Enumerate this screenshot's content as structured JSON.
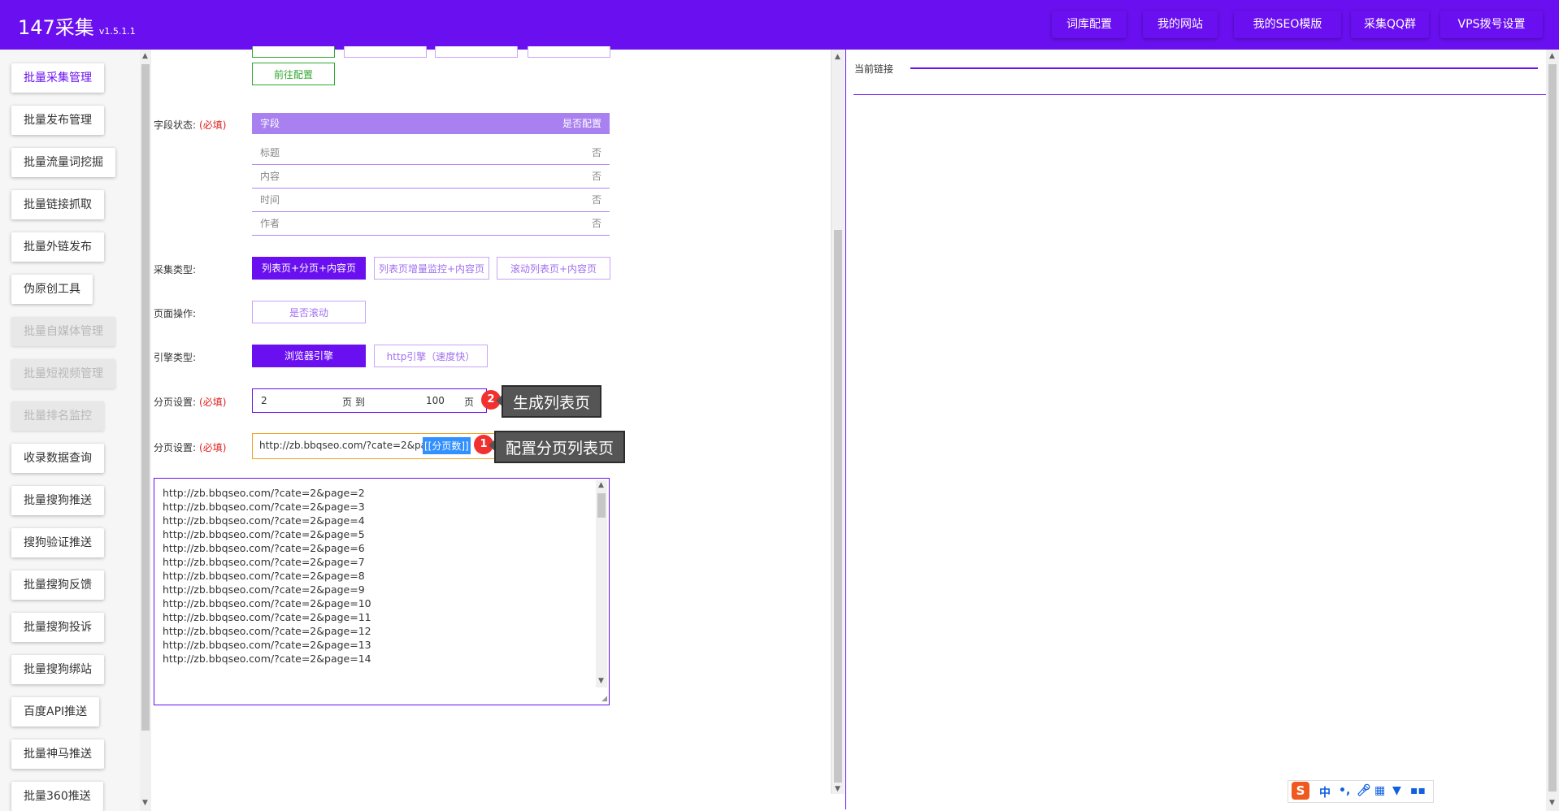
{
  "header": {
    "brand": "147采集",
    "version": "v1.5.1.1",
    "nav": [
      "词库配置",
      "我的网站",
      "我的SEO模版",
      "采集QQ群",
      "VPS拨号设置"
    ]
  },
  "sidebar": {
    "items": [
      {
        "label": "批量采集管理",
        "state": "active"
      },
      {
        "label": "批量发布管理",
        "state": "normal"
      },
      {
        "label": "批量流量词挖掘",
        "state": "normal"
      },
      {
        "label": "批量链接抓取",
        "state": "normal"
      },
      {
        "label": "批量外链发布",
        "state": "normal"
      },
      {
        "label": "伪原创工具",
        "state": "normal"
      },
      {
        "label": "批量自媒体管理",
        "state": "disabled"
      },
      {
        "label": "批量短视频管理",
        "state": "disabled"
      },
      {
        "label": "批量排名监控",
        "state": "disabled"
      },
      {
        "label": "收录数据查询",
        "state": "normal"
      },
      {
        "label": "批量搜狗推送",
        "state": "normal"
      },
      {
        "label": "搜狗验证推送",
        "state": "normal"
      },
      {
        "label": "批量搜狗反馈",
        "state": "normal"
      },
      {
        "label": "批量搜狗投诉",
        "state": "normal"
      },
      {
        "label": "批量搜狗绑站",
        "state": "normal"
      },
      {
        "label": "百度API推送",
        "state": "normal"
      },
      {
        "label": "批量神马推送",
        "state": "normal"
      },
      {
        "label": "批量360推送",
        "state": "normal"
      }
    ]
  },
  "form": {
    "goto_config": "前往配置",
    "field_status": {
      "label": "字段状态:",
      "required": "(必填)",
      "col_field": "字段",
      "col_config": "是否配置",
      "rows": [
        {
          "field": "标题",
          "config": "否"
        },
        {
          "field": "内容",
          "config": "否"
        },
        {
          "field": "时间",
          "config": "否"
        },
        {
          "field": "作者",
          "config": "否"
        }
      ]
    },
    "collect_type": {
      "label": "采集类型:",
      "options": [
        "列表页+分页+内容页",
        "列表页增量监控+内容页",
        "滚动列表页+内容页"
      ]
    },
    "page_action": {
      "label": "页面操作:",
      "option": "是否滚动"
    },
    "engine": {
      "label": "引擎类型:",
      "options": [
        "浏览器引擎",
        "http引擎（速度快）"
      ]
    },
    "pagination_range": {
      "label": "分页设置:",
      "required": "(必填)",
      "from": "2",
      "unit1": "页 到",
      "to": "100",
      "unit2": "页"
    },
    "pagination_url": {
      "label": "分页设置:",
      "required": "(必填)",
      "url_prefix": "http://zb.bbqseo.com/?cate=2&page=",
      "selected_token": "[[分页数]]"
    },
    "generated_urls": [
      "http://zb.bbqseo.com/?cate=2&page=2",
      "http://zb.bbqseo.com/?cate=2&page=3",
      "http://zb.bbqseo.com/?cate=2&page=4",
      "http://zb.bbqseo.com/?cate=2&page=5",
      "http://zb.bbqseo.com/?cate=2&page=6",
      "http://zb.bbqseo.com/?cate=2&page=7",
      "http://zb.bbqseo.com/?cate=2&page=8",
      "http://zb.bbqseo.com/?cate=2&page=9",
      "http://zb.bbqseo.com/?cate=2&page=10",
      "http://zb.bbqseo.com/?cate=2&page=11",
      "http://zb.bbqseo.com/?cate=2&page=12",
      "http://zb.bbqseo.com/?cate=2&page=13",
      "http://zb.bbqseo.com/?cate=2&page=14"
    ]
  },
  "callouts": [
    {
      "number": "2",
      "text": "生成列表页"
    },
    {
      "number": "1",
      "text": "配置分页列表页"
    }
  ],
  "right_panel": {
    "current_link_label": "当前链接"
  },
  "ime": {
    "lang": "中",
    "logo": "S"
  },
  "colors": {
    "primary": "#6a10f0",
    "required": "#e02020",
    "badge": "#f23030"
  }
}
